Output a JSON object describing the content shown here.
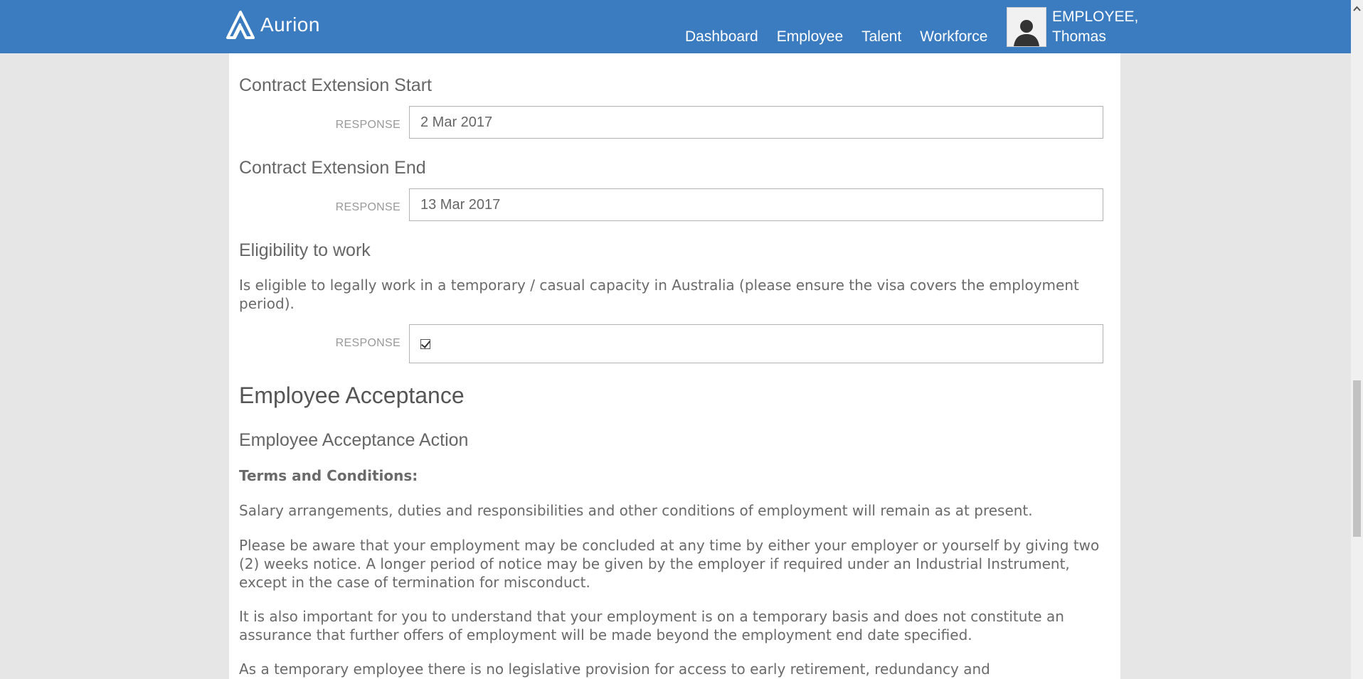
{
  "header": {
    "brand": "Aurion",
    "nav": [
      "Dashboard",
      "Employee",
      "Talent",
      "Workforce"
    ],
    "user": {
      "line1": "EMPLOYEE,",
      "line2": "Thomas"
    }
  },
  "fields": {
    "contract_start": {
      "title": "Contract Extension Start",
      "label": "RESPONSE",
      "value": "2 Mar 2017"
    },
    "contract_end": {
      "title": "Contract Extension End",
      "label": "RESPONSE",
      "value": "13 Mar 2017"
    },
    "eligibility": {
      "title": "Eligibility to work",
      "description": "Is eligible to legally work in a temporary / casual capacity in Australia (please ensure the visa covers the employment period).",
      "label": "RESPONSE",
      "checked": true
    }
  },
  "acceptance": {
    "section_title": "Employee Acceptance",
    "action_title": "Employee Acceptance Action",
    "terms_heading": "Terms and Conditions:",
    "paragraphs": [
      "Salary arrangements, duties and responsibilities and other conditions of employment will remain as at present.",
      "Please be aware that your employment may be concluded at any time by either your employer or yourself by giving two (2) weeks notice. A longer period of notice may be given by the employer if required under an Industrial Instrument, except in the case of termination for misconduct.",
      "It is also important for you to understand that your employment is on a temporary basis and does not constitute an assurance that further offers of employment will be made beyond the employment end date specified.",
      "As a temporary employee there is no legislative provision for access to early retirement, redundancy and"
    ]
  },
  "icons": {
    "logo": "aurion-logo-icon",
    "avatar": "user-avatar-icon",
    "scroll_up": "chevron-up-icon",
    "checkbox": "checkbox-checked-icon"
  }
}
